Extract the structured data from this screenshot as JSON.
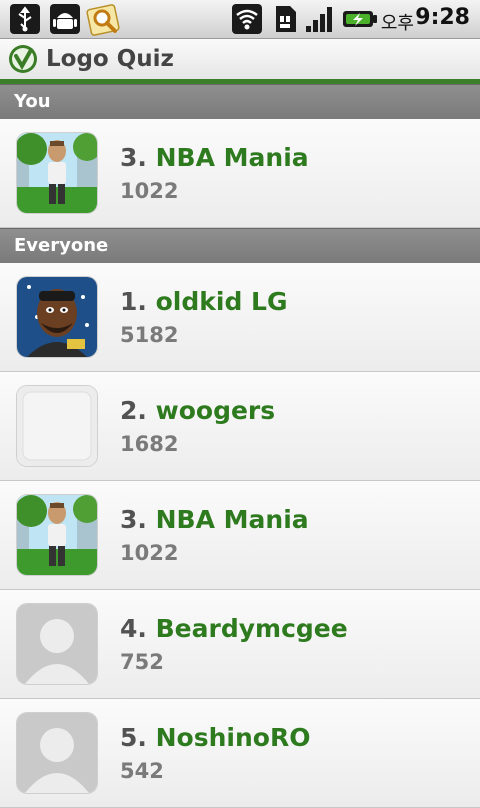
{
  "status_bar": {
    "ampm": "오후",
    "time": "9:28",
    "icons": [
      "usb-icon",
      "android-debug-icon",
      "search-notify-icon",
      "wifi-icon",
      "sim-icon",
      "signal-icon",
      "battery-charging-icon"
    ]
  },
  "app": {
    "title": "Logo Quiz",
    "accent": "#3c7f2a",
    "name_color": "#2e7a1e"
  },
  "sections": {
    "you": "You",
    "everyone": "Everyone"
  },
  "you_entry": {
    "rank": "3.",
    "name": "NBA Mania",
    "score": "1022",
    "avatar": "avatar-park"
  },
  "everyone": [
    {
      "rank": "1.",
      "name": "oldkid LG",
      "score": "5182",
      "avatar": "avatar-person"
    },
    {
      "rank": "2.",
      "name": "woogers",
      "score": "1682",
      "avatar": "avatar-blank"
    },
    {
      "rank": "3.",
      "name": "NBA Mania",
      "score": "1022",
      "avatar": "avatar-park"
    },
    {
      "rank": "4.",
      "name": "Beardymcgee",
      "score": "752",
      "avatar": "avatar-silhouette"
    },
    {
      "rank": "5.",
      "name": "NoshinoRO",
      "score": "542",
      "avatar": "avatar-silhouette"
    }
  ]
}
